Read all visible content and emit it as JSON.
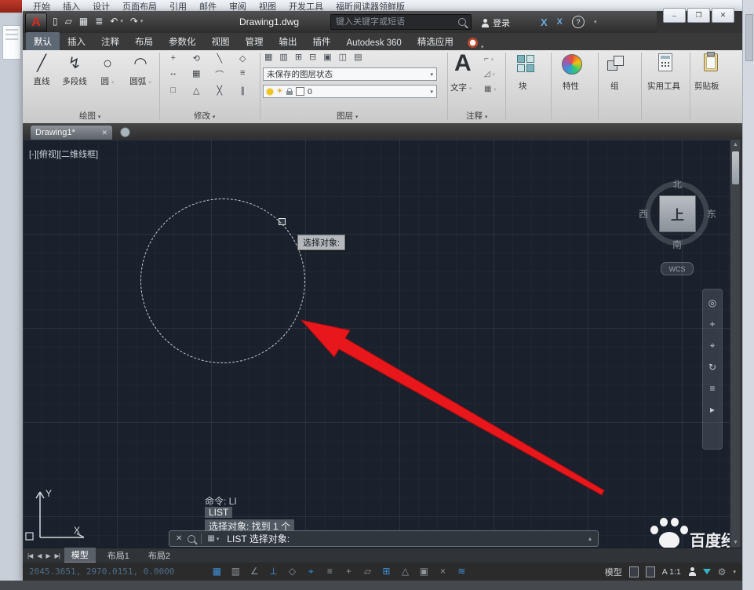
{
  "glyphs": {
    "caret": "▾",
    "caret_up": "▴",
    "close": "✕",
    "min": "–",
    "max": "❐",
    "new": "▯",
    "open": "▱",
    "save": "▦",
    "plot": "≣",
    "undo": "↶",
    "redo": "↷",
    "nav_first": "|◀",
    "nav_prev": "◀",
    "nav_next": "▶",
    "nav_last": "▶|",
    "ring": "◎",
    "plus": "+",
    "target": "⌖",
    "orbit": "↻",
    "list": "≡",
    "play": "▸",
    "up": "▲",
    "down": "▼",
    "help": "?",
    "x": "X",
    "sun": "☀",
    "gear": "⚙",
    "grid": "▦"
  },
  "bg_window": {
    "menu": [
      "开始",
      "插入",
      "设计",
      "页面布局",
      "引用",
      "邮件",
      "审阅",
      "视图",
      "开发工具",
      "福昕阅读器领鲜版"
    ]
  },
  "titlebar": {
    "logo": "A",
    "doc_title": "Drawing1.dwg",
    "search_placeholder": "键入关键字或短语",
    "signin": "登录"
  },
  "ribbon": {
    "tabs": [
      {
        "label": "默认"
      },
      {
        "label": "插入"
      },
      {
        "label": "注释"
      },
      {
        "label": "布局"
      },
      {
        "label": "参数化"
      },
      {
        "label": "视图"
      },
      {
        "label": "管理"
      },
      {
        "label": "输出"
      },
      {
        "label": "插件"
      },
      {
        "label": "Autodesk 360"
      },
      {
        "label": "精选应用"
      }
    ],
    "draw": {
      "panel": "绘图",
      "tools": [
        {
          "label": "直线",
          "glyph": "╱"
        },
        {
          "label": "多段线",
          "glyph": "↯"
        },
        {
          "label": "圆",
          "glyph": "○"
        },
        {
          "label": "圆弧",
          "glyph": "◠"
        }
      ]
    },
    "modify": {
      "panel": "修改",
      "icons": [
        "+",
        "⟲",
        "╲",
        "◇",
        "↔",
        "▦",
        "⌒",
        "≡",
        "□",
        "△",
        "╳",
        "∥"
      ]
    },
    "layers": {
      "panel": "图层",
      "tool_icons": [
        "▦",
        "▥",
        "⊞",
        "⊟",
        "▣",
        "◫",
        "▤"
      ],
      "state_combo": "未保存的图层状态",
      "layer_combo": "0"
    },
    "annotate": {
      "panel": "注释",
      "big_a": "A",
      "text_label": "文字"
    },
    "block": {
      "label": "块"
    },
    "properties": {
      "label": "特性"
    },
    "group": {
      "label": "组"
    },
    "utilities": {
      "label": "实用工具"
    },
    "clipboard": {
      "label": "剪贴板"
    }
  },
  "file_tabs": {
    "active": "Drawing1*"
  },
  "canvas": {
    "viewport_label": "[-][俯视][二维线框]",
    "viewcube": {
      "north": "北",
      "south": "南",
      "west": "西",
      "east": "东",
      "top": "上"
    },
    "wcs_label": "WCS",
    "tooltip": "选择对象:",
    "history": [
      "命令: LI",
      "LIST",
      "选择对象: 找到 1 个"
    ],
    "command_text": "LIST 选择对象:",
    "axis_x": "X",
    "axis_y": "Y",
    "watermark": "百度经验"
  },
  "layout_bar": {
    "tabs": [
      {
        "label": "模型"
      },
      {
        "label": "布局1"
      },
      {
        "label": "布局2"
      }
    ]
  },
  "statusbar": {
    "coords": "2045.3651, 2970.0151, 0.0000",
    "icons": [
      "▦",
      "▥",
      "∠",
      "⊥",
      "◇",
      "⌖",
      "≡",
      "+",
      "▱",
      "⊞",
      "△",
      "▣",
      "×",
      "≋"
    ],
    "model_label": "模型",
    "scale_label": "A 1:1"
  }
}
